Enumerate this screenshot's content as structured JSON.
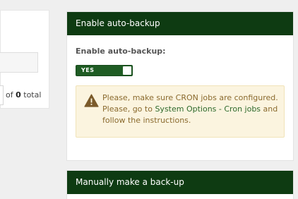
{
  "left_panel": {
    "total_prefix": "of",
    "total_count": "0",
    "total_suffix": "total"
  },
  "auto_backup_card": {
    "title": "Enable auto-backup",
    "field_label": "Enable auto-backup:",
    "toggle_label": "YES",
    "toggle_on": true,
    "alert": {
      "line1": "Please, make sure CRON jobs are configured.",
      "line2_prefix": "Please, go to",
      "link_text": "System Options - Cron jobs",
      "line2_suffix": "and",
      "line3": "follow the instructions."
    }
  },
  "manual_backup_card": {
    "title": "Manually make a back-up"
  },
  "colors": {
    "header_bg": "#0e3b12",
    "toggle_bg": "#1f5c24",
    "alert_bg": "#fbf4df",
    "alert_text": "#8a6a2e",
    "link": "#2f6a2c",
    "warning_icon": "#7a5a2a"
  },
  "icons": {
    "alert_icon": "warning-triangle-icon"
  }
}
